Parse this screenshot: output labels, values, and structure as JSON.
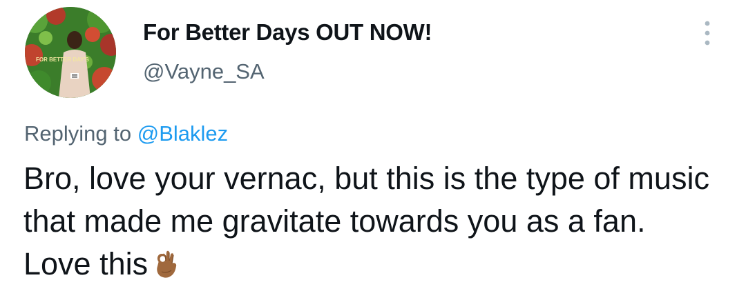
{
  "author": {
    "display_name": "For Better Days OUT NOW!",
    "handle": "@Vayne_SA",
    "avatar_icon": "profile-photo-avatar",
    "avatar_text": "FOR BETTER DAY'S"
  },
  "reply": {
    "prefix": "Replying to",
    "mention": "@Blaklez"
  },
  "tweet": {
    "text": "Bro, love your vernac, but this is the type of music that made me gravitate towards you as a fan. Love this",
    "emoji_icon": "ok-hand-emoji-icon"
  },
  "colors": {
    "text_primary": "#0f1419",
    "text_secondary": "#536471",
    "accent": "#1d9bf0"
  }
}
